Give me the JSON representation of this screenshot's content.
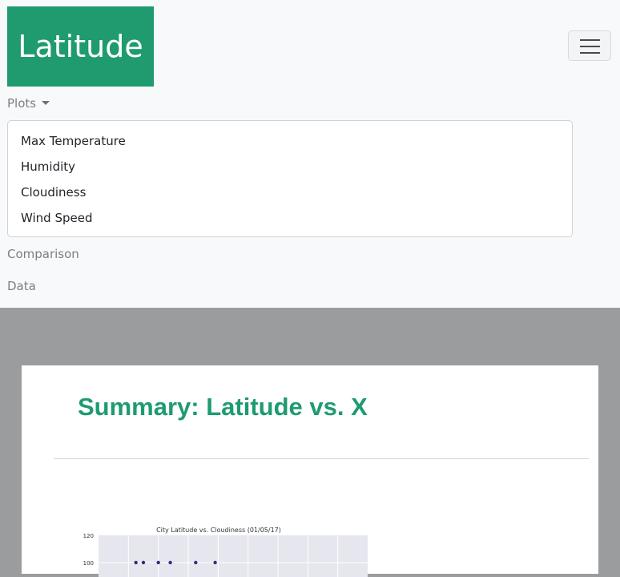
{
  "navbar": {
    "brand": "Latitude",
    "toggler_icon": "hamburger-menu-icon",
    "plots_label": "Plots",
    "dropdown_items": [
      "Max Temperature",
      "Humidity",
      "Cloudiness",
      "Wind Speed"
    ],
    "comparison_label": "Comparison",
    "data_label": "Data"
  },
  "main": {
    "summary_title": "Summary: Latitude vs. X"
  },
  "colors": {
    "brand": "#1f9b6f",
    "backdrop": "#9b9c9e",
    "point": "#2b2f7c"
  },
  "chart_data": {
    "type": "scatter",
    "title": "City Latitude vs. Cloudiness (01/05/17)",
    "xlabel": "",
    "ylabel": "",
    "ylim": [
      80,
      120
    ],
    "yticks": [
      120,
      100
    ],
    "x": [
      -55,
      -50,
      -40,
      -32,
      -15,
      -2
    ],
    "y": [
      100,
      100,
      100,
      100,
      100,
      100
    ]
  }
}
